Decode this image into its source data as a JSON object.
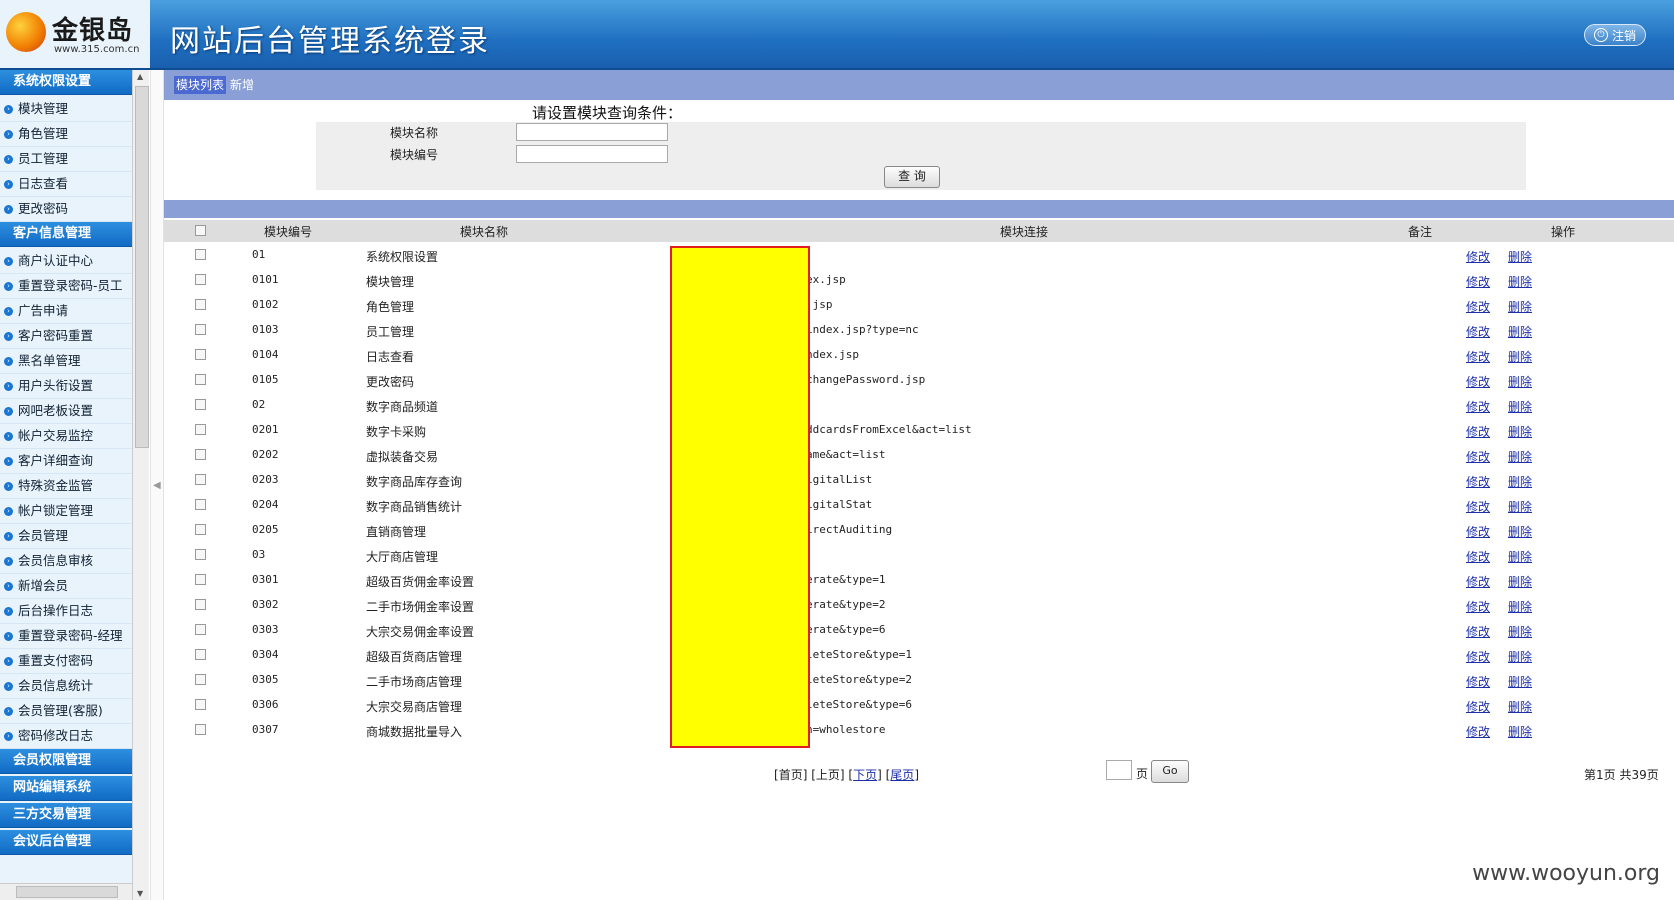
{
  "header": {
    "logo_text": "金银岛",
    "logo_url": "www.315.com.cn",
    "title": "网站后台管理系统登录",
    "logout_label": "注销"
  },
  "sidebar": {
    "groups": [
      {
        "label": "系统权限设置"
      },
      {
        "label": "客户信息管理"
      },
      {
        "label": "会员权限管理"
      },
      {
        "label": "网站编辑系统"
      },
      {
        "label": "三方交易管理"
      },
      {
        "label": "会议后台管理"
      }
    ],
    "system_items": [
      "模块管理",
      "角色管理",
      "员工管理",
      "日志查看",
      "更改密码"
    ],
    "customer_items": [
      "商户认证中心",
      "重置登录密码-员工",
      "广告申请",
      "客户密码重置",
      "黑名单管理",
      "用户头衔设置",
      "网吧老板设置",
      "帐户交易监控",
      "客户详细查询",
      "特殊资金监管",
      "帐户锁定管理",
      "会员管理",
      "会员信息审核",
      "新增会员",
      "后台操作日志",
      "重置登录密码-经理",
      "重置支付密码",
      "会员信息统计",
      "会员管理(客服)",
      "密码修改日志"
    ]
  },
  "tabs": {
    "list": "模块列表",
    "new": "新增"
  },
  "query": {
    "title": "请设置模块查询条件：",
    "name_label": "模块名称",
    "code_label": "模块编号",
    "name_value": "",
    "code_value": "",
    "submit_label": "查 询"
  },
  "table": {
    "headers": {
      "code": "模块编号",
      "name": "模块名称",
      "link": "模块连接",
      "remark": "备注",
      "action": "操作"
    },
    "edit_label": "修改",
    "delete_label": "删除",
    "rows": [
      {
        "code": "01",
        "name": "系统权限设置",
        "link": ""
      },
      {
        "code": "0101",
        "name": "模块管理",
        "link": "ex.jsp"
      },
      {
        "code": "0102",
        "name": "角色管理",
        "link": ".jsp"
      },
      {
        "code": "0103",
        "name": "员工管理",
        "link": "index.jsp?type=nc"
      },
      {
        "code": "0104",
        "name": "日志查看",
        "link": "ndex.jsp"
      },
      {
        "code": "0105",
        "name": "更改密码",
        "link": "changePassword.jsp"
      },
      {
        "code": "02",
        "name": "数字商品频道",
        "link": ""
      },
      {
        "code": "0201",
        "name": "数字卡采购",
        "link": "ddcardsFromExcel&act=list"
      },
      {
        "code": "0202",
        "name": "虚拟装备交易",
        "link": "ame&act=list"
      },
      {
        "code": "0203",
        "name": "数字商品库存查询",
        "link": "igitalList"
      },
      {
        "code": "0204",
        "name": "数字商品销售统计",
        "link": "igitalStat"
      },
      {
        "code": "0205",
        "name": "直销商管理",
        "link": "irectAuditing"
      },
      {
        "code": "03",
        "name": "大厅商店管理",
        "link": ""
      },
      {
        "code": "0301",
        "name": "超级百货佣金率设置",
        "link": "erate&type=1"
      },
      {
        "code": "0302",
        "name": "二手市场佣金率设置",
        "link": "erate&type=2"
      },
      {
        "code": "0303",
        "name": "大宗交易佣金率设置",
        "link": "erate&type=6"
      },
      {
        "code": "0304",
        "name": "超级百货商店管理",
        "link": "leteStore&type=1"
      },
      {
        "code": "0305",
        "name": "二手市场商店管理",
        "link": "leteStore&type=2"
      },
      {
        "code": "0306",
        "name": "大宗交易商店管理",
        "link": "leteStore&type=6"
      },
      {
        "code": "0307",
        "name": "商城数据批量导入",
        "link": "n=wholestore"
      }
    ]
  },
  "pager": {
    "first": "首页",
    "prev": "上页",
    "next": "下页",
    "last": "尾页",
    "page_label": "页",
    "go_label": "Go",
    "page_value": "",
    "info": "第1页 共39页"
  },
  "watermark": "www.wooyun.org"
}
